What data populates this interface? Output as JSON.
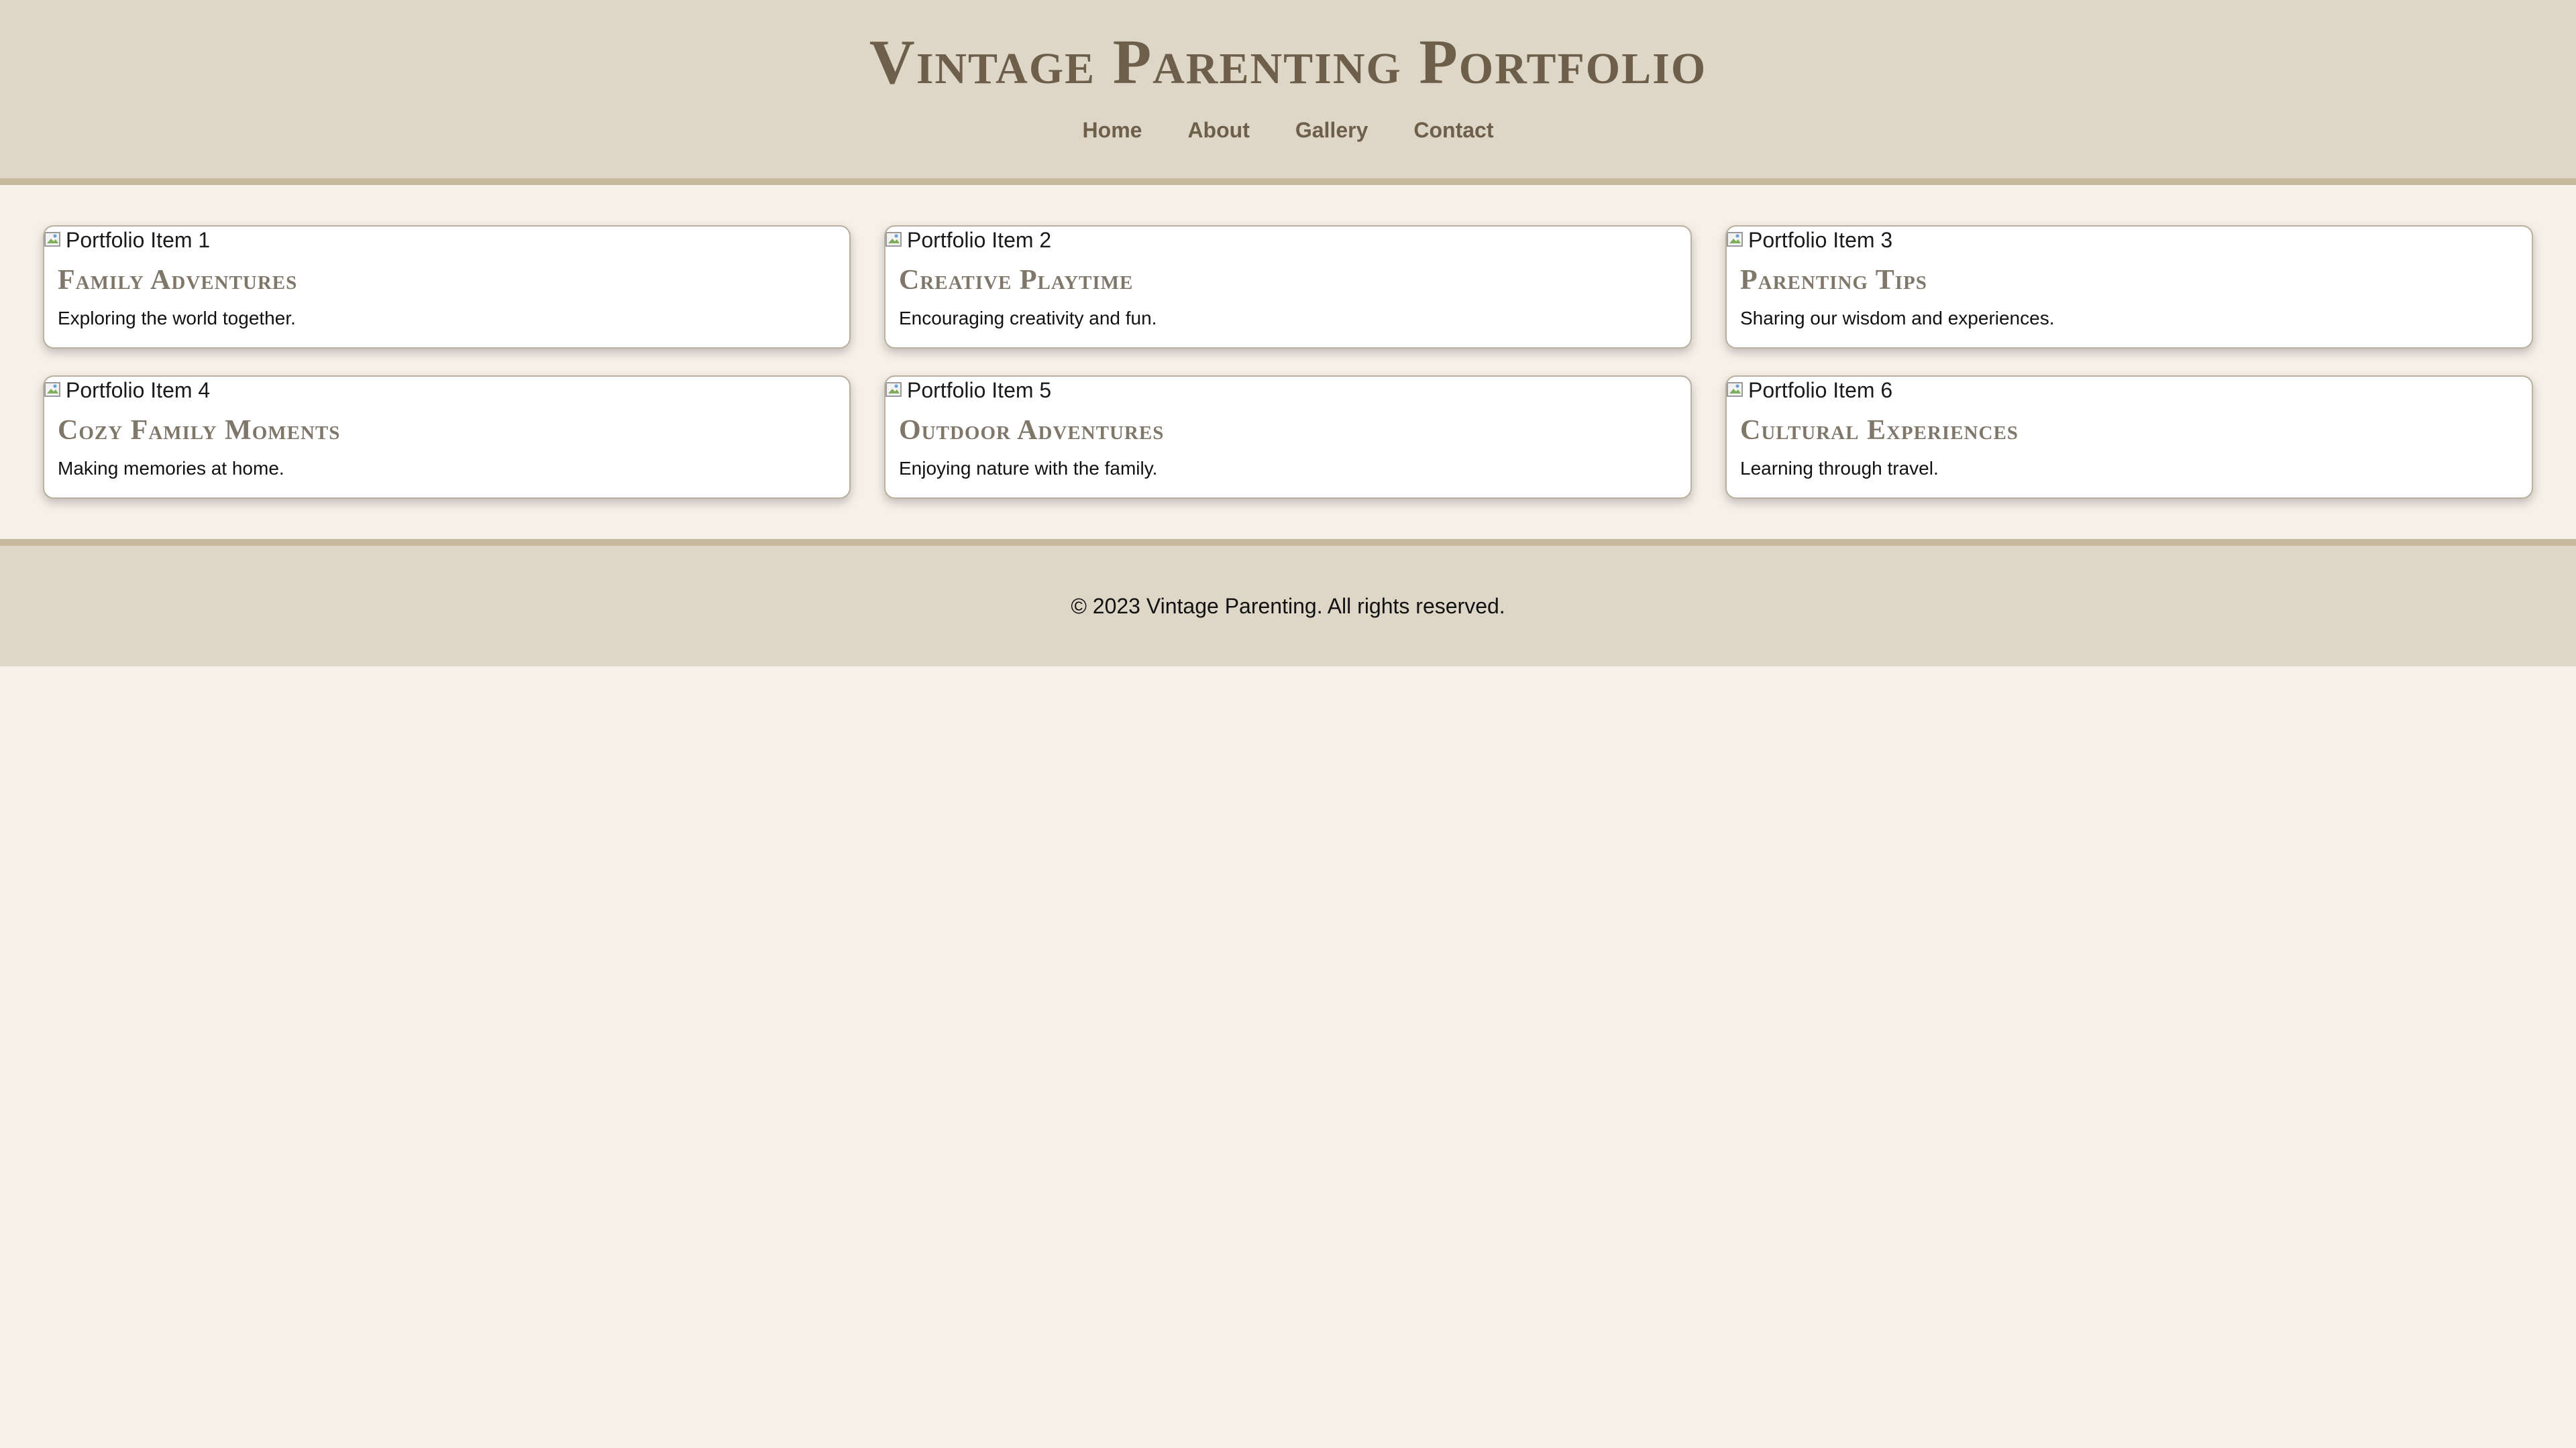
{
  "header": {
    "title": "Vintage Parenting Portfolio",
    "nav": [
      {
        "label": "Home"
      },
      {
        "label": "About"
      },
      {
        "label": "Gallery"
      },
      {
        "label": "Contact"
      }
    ]
  },
  "portfolio": {
    "items": [
      {
        "image_alt": "Portfolio Item 1",
        "title": "Family Adventures",
        "description": "Exploring the world together."
      },
      {
        "image_alt": "Portfolio Item 2",
        "title": "Creative Playtime",
        "description": "Encouraging creativity and fun."
      },
      {
        "image_alt": "Portfolio Item 3",
        "title": "Parenting Tips",
        "description": "Sharing our wisdom and experiences."
      },
      {
        "image_alt": "Portfolio Item 4",
        "title": "Cozy Family Moments",
        "description": "Making memories at home."
      },
      {
        "image_alt": "Portfolio Item 5",
        "title": "Outdoor Adventures",
        "description": "Enjoying nature with the family."
      },
      {
        "image_alt": "Portfolio Item 6",
        "title": "Cultural Experiences",
        "description": "Learning through travel."
      }
    ]
  },
  "footer": {
    "text": "© 2023 Vintage Parenting. All rights reserved."
  },
  "colors": {
    "page_background": "#f5f0e8",
    "header_background": "#ded6c6",
    "header_border": "#c6b99e",
    "title_color": "#6d5f4a",
    "card_title_color": "#80776b"
  },
  "icons": {
    "image_placeholder": "broken-image-icon"
  }
}
